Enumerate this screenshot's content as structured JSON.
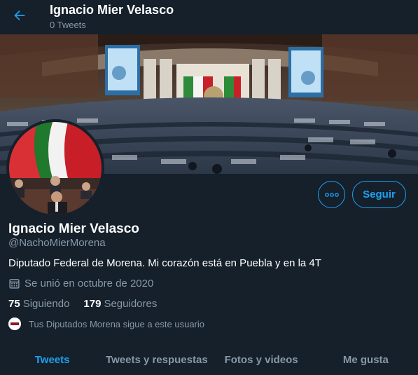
{
  "header": {
    "name": "Ignacio Mier Velasco",
    "tweet_count": "0 Tweets",
    "back_icon": "arrow-left-icon"
  },
  "profile": {
    "name": "Ignacio Mier Velasco",
    "handle": "@NachoMierMorena",
    "bio": "Diputado Federal de Morena. Mi corazón está en Puebla y en la 4T",
    "joined": "Se unió en octubre de 2020",
    "following_count": "75",
    "following_label": "Siguiendo",
    "followers_count": "179",
    "followers_label": "Seguidores",
    "followed_by": "Tus Diputados Morena sigue a este usuario"
  },
  "actions": {
    "more_icon": "more-options-icon",
    "follow_label": "Seguir"
  },
  "tabs": [
    {
      "label": "Tweets",
      "active": true
    },
    {
      "label": "Tweets y respuestas",
      "active": false
    },
    {
      "label": "Fotos y videos",
      "active": false
    },
    {
      "label": "Me gusta",
      "active": false
    }
  ],
  "colors": {
    "background": "#15202b",
    "accent": "#1da1f2",
    "secondary_text": "#8899a6"
  }
}
